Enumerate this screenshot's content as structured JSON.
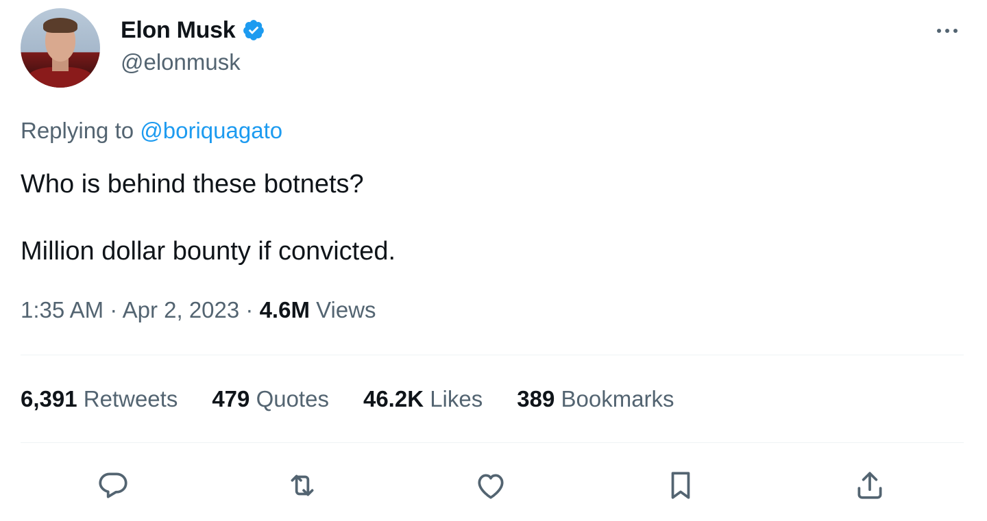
{
  "author": {
    "name": "Elon Musk",
    "handle": "@elonmusk",
    "verified": true,
    "verified_color": "#1d9bf0"
  },
  "reply": {
    "prefix": "Replying to",
    "mention": "@boriquagato"
  },
  "tweet": {
    "line1": "Who is behind these botnets?",
    "line2": "Million dollar bounty if convicted."
  },
  "meta": {
    "time": "1:35 AM",
    "separator": "·",
    "date": "Apr 2, 2023",
    "views_count": "4.6M",
    "views_label": "Views"
  },
  "stats": {
    "retweets": {
      "count": "6,391",
      "label": "Retweets"
    },
    "quotes": {
      "count": "479",
      "label": "Quotes"
    },
    "likes": {
      "count": "46.2K",
      "label": "Likes"
    },
    "bookmarks": {
      "count": "389",
      "label": "Bookmarks"
    }
  },
  "actions": [
    {
      "icon": "reply-icon"
    },
    {
      "icon": "retweet-icon"
    },
    {
      "icon": "like-icon"
    },
    {
      "icon": "bookmark-icon"
    },
    {
      "icon": "share-icon"
    }
  ],
  "colors": {
    "text": "#0f1419",
    "secondary": "#536471",
    "link": "#1d9bf0",
    "divider": "#eff3f4"
  }
}
